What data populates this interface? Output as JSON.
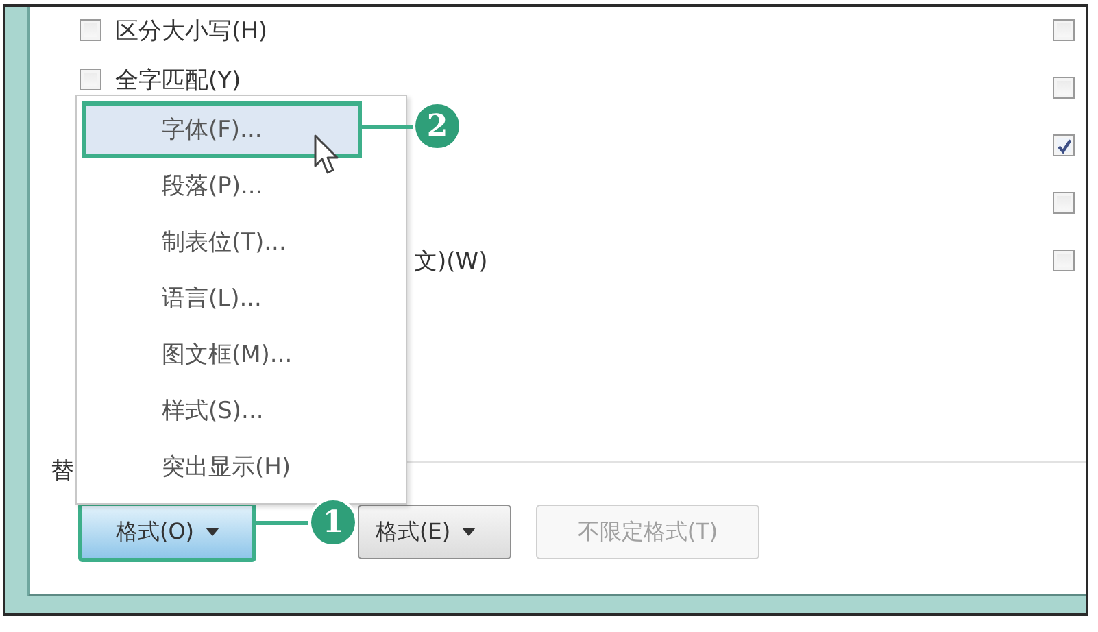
{
  "options_left": [
    {
      "label": "区分大小写(H)",
      "checked": false
    },
    {
      "label": "全字匹配(Y)",
      "checked": false
    }
  ],
  "partial_option": {
    "label": "文)(W)"
  },
  "options_right": [
    {
      "checked": false
    },
    {
      "checked": false
    },
    {
      "checked": true
    },
    {
      "checked": false
    },
    {
      "checked": false
    }
  ],
  "replace_label": "替",
  "format_menu": {
    "items": [
      {
        "label": "字体(F)...",
        "selected": true
      },
      {
        "label": "段落(P)...",
        "selected": false
      },
      {
        "label": "制表位(T)...",
        "selected": false
      },
      {
        "label": "语言(L)...",
        "selected": false
      },
      {
        "label": "图文框(M)...",
        "selected": false
      },
      {
        "label": "样式(S)...",
        "selected": false
      },
      {
        "label": "突出显示(H)",
        "selected": false
      }
    ]
  },
  "buttons": [
    {
      "label": "格式(O)",
      "kind": "dropdown",
      "active": true,
      "disabled": false
    },
    {
      "label": "格式(E)",
      "kind": "dropdown",
      "active": false,
      "disabled": false
    },
    {
      "label": "不限定格式(T)",
      "kind": "plain",
      "active": false,
      "disabled": true
    }
  ],
  "callouts": [
    {
      "number": "2"
    },
    {
      "number": "1"
    }
  ]
}
